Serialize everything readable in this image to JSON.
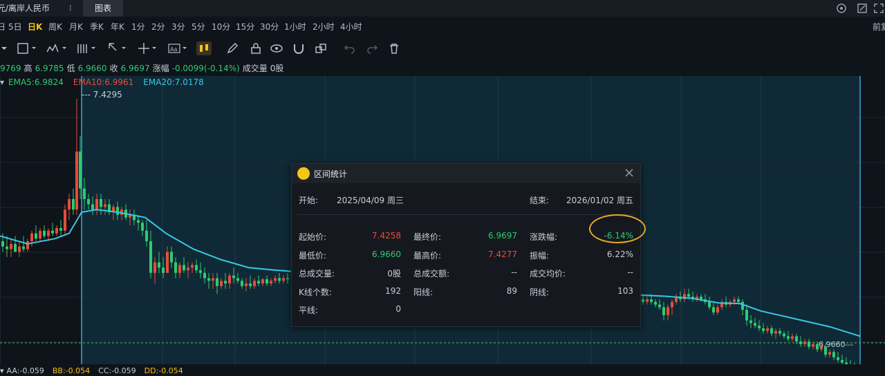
{
  "tabs": {
    "pair": "元/离岸人民币",
    "sep": "I",
    "chart": "图表"
  },
  "periods": [
    "日K",
    "5日",
    "日K",
    "周K",
    "月K",
    "季K",
    "年K",
    "1分",
    "2分",
    "3分",
    "5分",
    "10分",
    "15分",
    "30分",
    "1小时",
    "2小时",
    "4小时",
    "前复"
  ],
  "periods_display": {
    "p_1": "5日",
    "p_2": "日K",
    "p_3": "周K",
    "p_4": "月K",
    "p_5": "季K",
    "p_6": "年K",
    "p_7": "1分",
    "p_8": "2分",
    "p_9": "3分",
    "p_10": "5分",
    "p_11": "10分",
    "p_12": "15分",
    "p_13": "30分",
    "p_14": "1小时",
    "p_15": "2小时",
    "p_16": "4小时",
    "p_17": "前复",
    "p_0": "日"
  },
  "ohlc": {
    "open_label": "9769",
    "high_label": "高",
    "high": "6.9785",
    "low_label": "低",
    "low": "6.9660",
    "close_label": "收",
    "close": "6.9697",
    "change_label": "涨幅",
    "change": "-0.0099(-0.14%)",
    "volume_label": "成交量",
    "volume": "0股"
  },
  "ema": {
    "ema5": "EMA5:6.9824",
    "ema10": "EMA10:6.9961",
    "ema20": "EMA20:7.0178"
  },
  "indicators": {
    "aa": "AA:-0.059",
    "bb": "BB:-0.054",
    "cc": "CC:-0.059",
    "dd": "DD:-0.054"
  },
  "colors": {
    "up": "#e74c3c",
    "down": "#2ecc71",
    "ema5": "#2ecc71",
    "ema10": "#e74c3c",
    "ema20": "#38c8e8",
    "highlight": "#e9a825",
    "active_period": "#f5c518"
  },
  "icons": [
    "settings-icon",
    "edit-icon",
    "fullscreen-icon",
    "rect-tool-icon",
    "indicator-icon",
    "bars-icon",
    "cursor-icon",
    "crosshair-icon",
    "text-tool-icon",
    "candle-icon",
    "pen-icon",
    "lock-icon",
    "eye-icon",
    "magnet-icon",
    "link-icon",
    "undo-icon",
    "redo-icon",
    "trash-icon",
    "close-icon"
  ],
  "dialog": {
    "title": "区间统计",
    "start_label": "开始:",
    "start_value": "2025/04/09 周三",
    "end_label": "结束:",
    "end_value": "2026/01/02 周五",
    "rows": {
      "open_label": "起始价:",
      "open_value": "7.4258",
      "final_label": "最终价:",
      "final_value": "6.9697",
      "change_label": "涨跌幅:",
      "change_value": "-6.14%",
      "low_label": "最低价:",
      "low_value": "6.9660",
      "high_label": "最高价:",
      "high_value": "7.4277",
      "amp_label": "振幅:",
      "amp_value": "6.22%",
      "vol_label": "总成交量:",
      "vol_value": "0股",
      "amt_label": "总成交额:",
      "amt_value": "--",
      "avg_label": "成交均价:",
      "avg_value": "--",
      "bars_label": "K线个数:",
      "bars_value": "192",
      "yang_label": "阳线:",
      "yang_value": "89",
      "yin_label": "阴线:",
      "yin_value": "103",
      "flat_label": "平线:",
      "flat_value": "0"
    }
  },
  "chart_data": {
    "type": "candlestick",
    "price_labels": {
      "high_marker": "7.4295",
      "last_marker": "6.9660"
    },
    "ylim": [
      6.94,
      7.46
    ],
    "ema20_path": [
      [
        0,
        7.17
      ],
      [
        40,
        7.155
      ],
      [
        80,
        7.165
      ],
      [
        100,
        7.175
      ],
      [
        118,
        7.215
      ],
      [
        140,
        7.22
      ],
      [
        170,
        7.215
      ],
      [
        210,
        7.205
      ],
      [
        240,
        7.175
      ],
      [
        280,
        7.145
      ],
      [
        320,
        7.125
      ],
      [
        360,
        7.11
      ],
      [
        400,
        7.105
      ],
      [
        421,
        7.103
      ],
      [
        925,
        7.058
      ],
      [
        960,
        7.056
      ],
      [
        1000,
        7.052
      ],
      [
        1040,
        7.043
      ],
      [
        1070,
        7.042
      ],
      [
        1100,
        7.028
      ],
      [
        1150,
        7.013
      ],
      [
        1200,
        6.998
      ],
      [
        1244,
        6.98
      ]
    ],
    "candles": [
      [
        4,
        7.16,
        7.175,
        7.14,
        7.15
      ],
      [
        10,
        7.15,
        7.17,
        7.13,
        7.145
      ],
      [
        16,
        7.145,
        7.165,
        7.13,
        7.155
      ],
      [
        22,
        7.155,
        7.17,
        7.14,
        7.14
      ],
      [
        28,
        7.14,
        7.16,
        7.13,
        7.15
      ],
      [
        34,
        7.15,
        7.17,
        7.14,
        7.145
      ],
      [
        40,
        7.145,
        7.165,
        7.14,
        7.16
      ],
      [
        46,
        7.16,
        7.18,
        7.15,
        7.175
      ],
      [
        52,
        7.175,
        7.19,
        7.16,
        7.165
      ],
      [
        58,
        7.165,
        7.185,
        7.16,
        7.18
      ],
      [
        64,
        7.18,
        7.19,
        7.165,
        7.17
      ],
      [
        70,
        7.17,
        7.185,
        7.16,
        7.18
      ],
      [
        76,
        7.18,
        7.195,
        7.17,
        7.175
      ],
      [
        82,
        7.175,
        7.19,
        7.17,
        7.185
      ],
      [
        88,
        7.185,
        7.2,
        7.17,
        7.18
      ],
      [
        94,
        7.18,
        7.23,
        7.17,
        7.22
      ],
      [
        100,
        7.22,
        7.25,
        7.2,
        7.24
      ],
      [
        106,
        7.24,
        7.26,
        7.21,
        7.22
      ],
      [
        111,
        7.22,
        7.43,
        7.21,
        7.33
      ],
      [
        116,
        7.33,
        7.36,
        7.24,
        7.26
      ],
      [
        122,
        7.26,
        7.28,
        7.22,
        7.24
      ],
      [
        128,
        7.24,
        7.25,
        7.22,
        7.23
      ],
      [
        134,
        7.23,
        7.245,
        7.21,
        7.22
      ],
      [
        140,
        7.22,
        7.25,
        7.21,
        7.24
      ],
      [
        146,
        7.24,
        7.25,
        7.21,
        7.225
      ],
      [
        152,
        7.225,
        7.24,
        7.21,
        7.23
      ],
      [
        158,
        7.23,
        7.24,
        7.21,
        7.215
      ],
      [
        164,
        7.215,
        7.23,
        7.2,
        7.225
      ],
      [
        170,
        7.225,
        7.235,
        7.2,
        7.21
      ],
      [
        176,
        7.21,
        7.225,
        7.2,
        7.22
      ],
      [
        182,
        7.22,
        7.23,
        7.2,
        7.205
      ],
      [
        188,
        7.205,
        7.22,
        7.19,
        7.21
      ],
      [
        194,
        7.21,
        7.22,
        7.19,
        7.2
      ],
      [
        200,
        7.2,
        7.21,
        7.18,
        7.195
      ],
      [
        206,
        7.195,
        7.2,
        7.17,
        7.18
      ],
      [
        212,
        7.18,
        7.2,
        7.15,
        7.16
      ],
      [
        218,
        7.16,
        7.18,
        7.09,
        7.1
      ],
      [
        224,
        7.1,
        7.13,
        7.08,
        7.12
      ],
      [
        230,
        7.12,
        7.14,
        7.1,
        7.11
      ],
      [
        236,
        7.11,
        7.13,
        7.09,
        7.1
      ],
      [
        242,
        7.1,
        7.15,
        7.1,
        7.14
      ],
      [
        248,
        7.14,
        7.15,
        7.11,
        7.12
      ],
      [
        254,
        7.12,
        7.13,
        7.09,
        7.1
      ],
      [
        260,
        7.1,
        7.12,
        7.09,
        7.115
      ],
      [
        266,
        7.115,
        7.13,
        7.1,
        7.105
      ],
      [
        272,
        7.105,
        7.12,
        7.09,
        7.11
      ],
      [
        278,
        7.11,
        7.12,
        7.1,
        7.115
      ],
      [
        284,
        7.115,
        7.125,
        7.1,
        7.105
      ],
      [
        290,
        7.105,
        7.12,
        7.09,
        7.1
      ],
      [
        296,
        7.1,
        7.11,
        7.08,
        7.09
      ],
      [
        302,
        7.09,
        7.1,
        7.07,
        7.085
      ],
      [
        308,
        7.085,
        7.1,
        7.07,
        7.09
      ],
      [
        314,
        7.09,
        7.1,
        7.06,
        7.075
      ],
      [
        320,
        7.075,
        7.09,
        7.07,
        7.085
      ],
      [
        326,
        7.085,
        7.1,
        7.07,
        7.08
      ],
      [
        332,
        7.08,
        7.1,
        7.07,
        7.095
      ],
      [
        338,
        7.095,
        7.11,
        7.08,
        7.09
      ],
      [
        344,
        7.09,
        7.1,
        7.08,
        7.085
      ],
      [
        350,
        7.085,
        7.09,
        7.07,
        7.075
      ],
      [
        356,
        7.075,
        7.09,
        7.065,
        7.08
      ],
      [
        362,
        7.08,
        7.095,
        7.07,
        7.075
      ],
      [
        368,
        7.075,
        7.09,
        7.07,
        7.085
      ],
      [
        374,
        7.085,
        7.095,
        7.075,
        7.08
      ],
      [
        380,
        7.08,
        7.09,
        7.075,
        7.088
      ],
      [
        386,
        7.088,
        7.095,
        7.075,
        7.08
      ],
      [
        392,
        7.08,
        7.09,
        7.075,
        7.085
      ],
      [
        398,
        7.085,
        7.095,
        7.08,
        7.09
      ],
      [
        404,
        7.09,
        7.1,
        7.08,
        7.085
      ],
      [
        410,
        7.085,
        7.095,
        7.08,
        7.09
      ],
      [
        416,
        7.09,
        7.1,
        7.08,
        7.088
      ],
      [
        930,
        7.05,
        7.06,
        7.04,
        7.045
      ],
      [
        936,
        7.045,
        7.055,
        7.04,
        7.05
      ],
      [
        942,
        7.05,
        7.06,
        7.04,
        7.045
      ],
      [
        948,
        7.045,
        7.05,
        7.035,
        7.04
      ],
      [
        954,
        7.04,
        7.05,
        7.03,
        7.035
      ],
      [
        960,
        7.035,
        7.045,
        7.01,
        7.02
      ],
      [
        966,
        7.02,
        7.04,
        7.01,
        7.035
      ],
      [
        972,
        7.035,
        7.05,
        7.02,
        7.045
      ],
      [
        978,
        7.045,
        7.06,
        7.04,
        7.055
      ],
      [
        984,
        7.055,
        7.065,
        7.045,
        7.05
      ],
      [
        990,
        7.05,
        7.07,
        7.045,
        7.06
      ],
      [
        996,
        7.06,
        7.07,
        7.05,
        7.055
      ],
      [
        1002,
        7.055,
        7.065,
        7.045,
        7.05
      ],
      [
        1008,
        7.05,
        7.06,
        7.045,
        7.055
      ],
      [
        1014,
        7.055,
        7.06,
        7.045,
        7.05
      ],
      [
        1020,
        7.05,
        7.06,
        7.04,
        7.045
      ],
      [
        1026,
        7.045,
        7.055,
        7.03,
        7.035
      ],
      [
        1032,
        7.035,
        7.045,
        7.02,
        7.025
      ],
      [
        1038,
        7.025,
        7.04,
        7.02,
        7.035
      ],
      [
        1044,
        7.035,
        7.05,
        7.03,
        7.045
      ],
      [
        1050,
        7.045,
        7.055,
        7.035,
        7.04
      ],
      [
        1056,
        7.04,
        7.05,
        7.035,
        7.045
      ],
      [
        1062,
        7.045,
        7.055,
        7.04,
        7.05
      ],
      [
        1068,
        7.05,
        7.055,
        7.04,
        7.045
      ],
      [
        1074,
        7.045,
        7.05,
        7.02,
        7.03
      ],
      [
        1080,
        7.03,
        7.04,
        7.0,
        7.01
      ],
      [
        1086,
        7.01,
        7.02,
        6.995,
        7.005
      ],
      [
        1092,
        7.005,
        7.015,
        6.995,
        7.0
      ],
      [
        1098,
        7.0,
        7.01,
        6.99,
        6.995
      ],
      [
        1104,
        6.995,
        7.005,
        6.985,
        6.99
      ],
      [
        1110,
        6.99,
        7.0,
        6.985,
        6.995
      ],
      [
        1116,
        6.995,
        7.0,
        6.98,
        6.985
      ],
      [
        1122,
        6.985,
        6.995,
        6.975,
        6.99
      ],
      [
        1128,
        6.99,
        6.995,
        6.98,
        6.985
      ],
      [
        1134,
        6.985,
        6.99,
        6.975,
        6.98
      ],
      [
        1140,
        6.98,
        6.99,
        6.97,
        6.975
      ],
      [
        1146,
        6.975,
        6.985,
        6.97,
        6.98
      ],
      [
        1152,
        6.98,
        6.985,
        6.965,
        6.97
      ],
      [
        1158,
        6.97,
        6.98,
        6.96,
        6.965
      ],
      [
        1164,
        6.965,
        6.975,
        6.96,
        6.97
      ],
      [
        1170,
        6.97,
        6.975,
        6.955,
        6.96
      ],
      [
        1176,
        6.96,
        6.97,
        6.955,
        6.965
      ],
      [
        1182,
        6.965,
        6.97,
        6.95,
        6.955
      ],
      [
        1188,
        6.955,
        6.965,
        6.95,
        6.96
      ],
      [
        1194,
        6.96,
        6.965,
        6.94,
        6.945
      ],
      [
        1200,
        6.945,
        6.955,
        6.94,
        6.95
      ],
      [
        1206,
        6.95,
        6.955,
        6.935,
        6.94
      ],
      [
        1212,
        6.94,
        6.95,
        6.93,
        6.935
      ],
      [
        1218,
        6.935,
        6.945,
        6.925,
        6.93
      ],
      [
        1224,
        6.93,
        6.94,
        6.92,
        6.925
      ],
      [
        1230,
        6.925,
        6.935,
        6.915,
        6.92
      ],
      [
        1236,
        6.92,
        6.93,
        6.91,
        6.915
      ],
      [
        1242,
        6.915,
        6.925,
        6.905,
        6.91
      ]
    ]
  }
}
